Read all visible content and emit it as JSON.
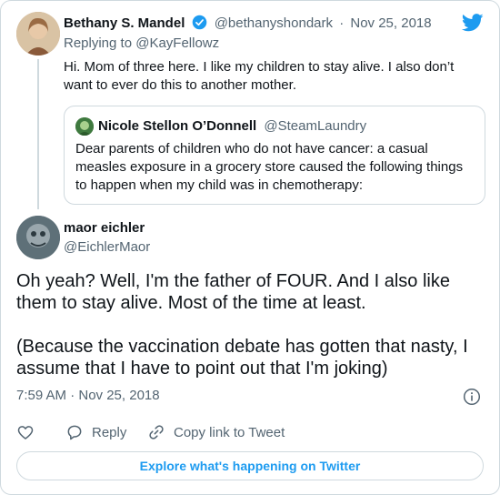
{
  "parent_tweet": {
    "display_name": "Bethany S. Mandel",
    "handle": "@bethanyshondark",
    "separator": "·",
    "date": "Nov 25, 2018",
    "replying_prefix": "Replying to",
    "replying_handle": "@KayFellowz",
    "text": "Hi. Mom of three here. I like my children to stay alive. I also don’t want to ever do this to another mother.",
    "quoted": {
      "display_name": "Nicole Stellon O’Donnell",
      "handle": "@SteamLaundry",
      "text": "Dear parents of children who do not have cancer: a casual measles exposure in a grocery store caused the following things to happen when my child was in chemotherapy:"
    }
  },
  "main_tweet": {
    "display_name": "maor eichler",
    "handle": "@EichlerMaor",
    "paragraph_1": "Oh yeah? Well, I'm the father of FOUR. And I also like them to stay alive. Most of the time at least.",
    "paragraph_2": "(Because the vaccination debate has gotten that nasty, I assume that I have to point out that I'm joking)",
    "timestamp": "7:59 AM · Nov 25, 2018"
  },
  "actions": {
    "reply_label": "Reply",
    "copy_link_label": "Copy link to Tweet"
  },
  "explore_label": "Explore what's happening on Twitter",
  "icons": {
    "brand": "twitter-bird-icon",
    "verified": "verified-badge-icon",
    "info": "info-icon",
    "like": "heart-icon",
    "reply": "reply-bubble-icon",
    "copy": "link-icon"
  },
  "colors": {
    "accent": "#1d9bf0",
    "secondary_text": "#536471",
    "border": "#cfd9de"
  }
}
